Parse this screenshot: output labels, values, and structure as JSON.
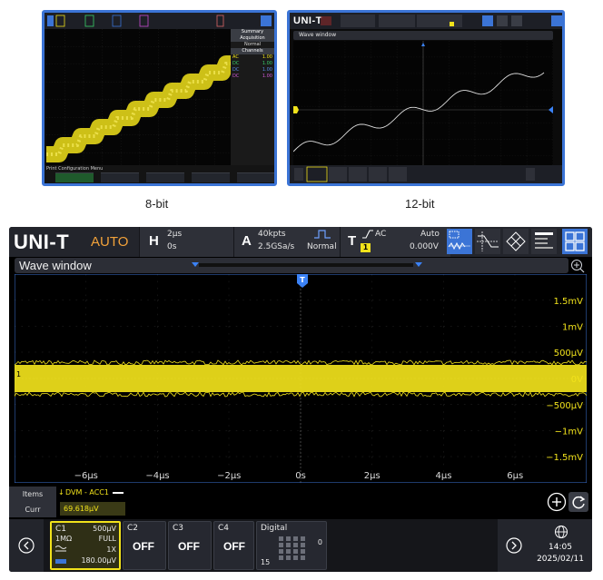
{
  "captions": {
    "eight_bit": "8-bit",
    "twelve_bit": "12-bit"
  },
  "thumb12": {
    "logo": "UNI-T",
    "wave_title": "Wave window"
  },
  "thumb8": {
    "menu_title": "Print Configuration Menu",
    "side_items": [
      "Summary",
      "Acquisition",
      "Normal",
      "Channels"
    ],
    "channels": [
      {
        "name": "AC",
        "value": "1.00"
      },
      {
        "name": "DC",
        "value": "1.00"
      },
      {
        "name": "DC",
        "value": "1.00"
      },
      {
        "name": "DC",
        "value": "1.00"
      }
    ]
  },
  "header": {
    "logo": "UNI-T",
    "mode": "AUTO",
    "h_letter": "H",
    "h_scale": "2μs",
    "h_offset": "0s",
    "a_letter": "A",
    "a_depth": "40kpts",
    "a_rate": "2.5GSa/s",
    "a_mode": "Normal",
    "t_letter": "T",
    "t_coupling": "AC",
    "t_source": "1",
    "t_sweep": "Auto",
    "t_level": "0.000V"
  },
  "wave": {
    "title": "Wave window",
    "trigger_marker": "T",
    "channel_marker": "1",
    "y_labels": [
      "1.5mV",
      "1mV",
      "500μV",
      "0V",
      "−500μV",
      "−1mV",
      "−1.5mV"
    ],
    "x_labels": [
      "−6μs",
      "−4μs",
      "−2μs",
      "0s",
      "2μs",
      "4μs",
      "6μs"
    ]
  },
  "measure": {
    "items_label": "Items",
    "curr_label": "Curr",
    "dvm_name": "DVM - ACC1",
    "dvm_value": "69.618μV"
  },
  "channels": {
    "c1": {
      "name": "C1",
      "scale": "500μV",
      "impedance": "1MΩ",
      "bandwidth": "FULL",
      "probe": "1X",
      "offset": "180.00μV"
    },
    "c2": {
      "name": "C2",
      "state": "OFF"
    },
    "c3": {
      "name": "C3",
      "state": "OFF"
    },
    "c4": {
      "name": "C4",
      "state": "OFF"
    },
    "digital": {
      "name": "Digital",
      "count": "0",
      "bus": "15"
    }
  },
  "status": {
    "time": "14:05",
    "date": "2025/02/11"
  },
  "colors": {
    "trace": "#f1e21b",
    "accent": "#3b74d6",
    "mode": "#f2a23a",
    "marker": "#3b82f6"
  }
}
